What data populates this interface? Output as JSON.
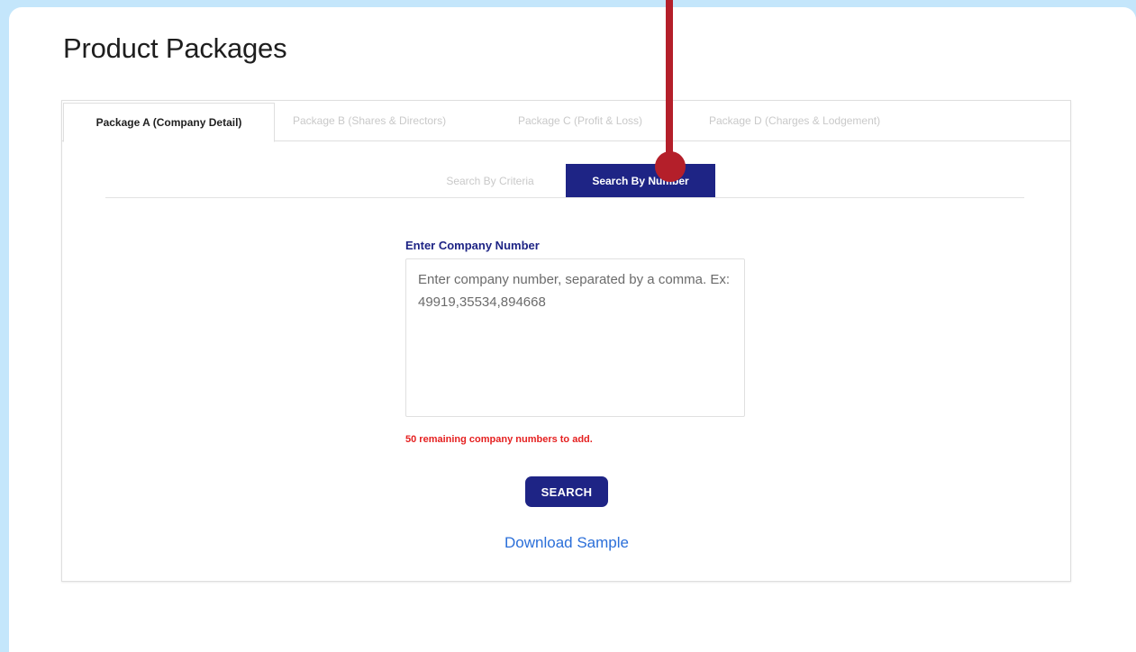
{
  "page": {
    "title": "Product Packages"
  },
  "package_tabs": [
    {
      "label": "Package A (Company Detail)",
      "active": true
    },
    {
      "label": "Package B (Shares & Directors)",
      "active": false
    },
    {
      "label": "Package C (Profit & Loss)",
      "active": false
    },
    {
      "label": "Package D (Charges & Lodgement)",
      "active": false
    }
  ],
  "search_tabs": [
    {
      "label": "Search By Criteria",
      "active": false
    },
    {
      "label": "Search By Number",
      "active": true
    }
  ],
  "form": {
    "label": "Enter Company Number",
    "value": "",
    "placeholder": "Enter company number, separated by a comma. Ex: 49919,35534,894668",
    "remaining_text": "50 remaining company numbers to add.",
    "search_label": "SEARCH",
    "download_label": "Download Sample"
  },
  "colors": {
    "background": "#c4e6fb",
    "accent": "#1e2485",
    "error": "#e52020",
    "link": "#2b6fd9",
    "pointer": "#b41f2a"
  }
}
